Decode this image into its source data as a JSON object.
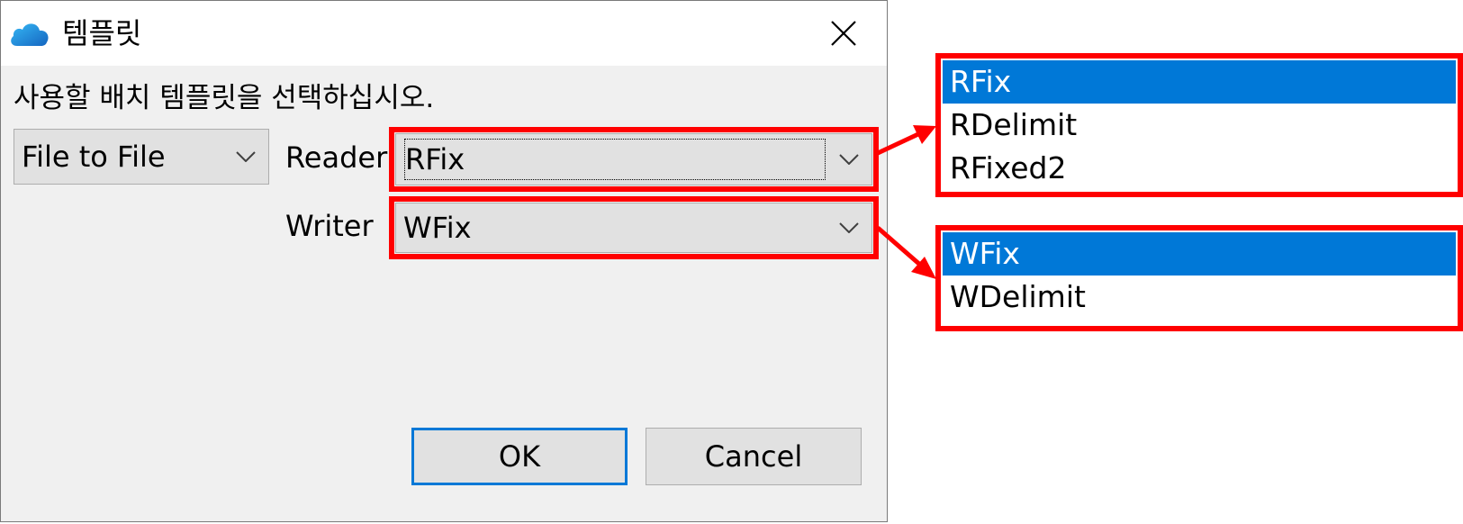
{
  "dialog": {
    "title": "템플릿",
    "instruction": "사용할 배치 템플릿을 선택하십시오.",
    "type_select": {
      "value": "File to File"
    },
    "reader": {
      "label": "Reader",
      "value": "RFix"
    },
    "writer": {
      "label": "Writer",
      "value": "WFix"
    },
    "ok_label": "OK",
    "cancel_label": "Cancel"
  },
  "reader_dropdown": {
    "options": [
      "RFix",
      "RDelimit",
      "RFixed2"
    ],
    "selected": "RFix"
  },
  "writer_dropdown": {
    "options": [
      "WFix",
      "WDelimit"
    ],
    "selected": "WFix"
  },
  "colors": {
    "highlight": "#ff0000",
    "selection": "#0078d7",
    "dialog_bg": "#f0f0f0"
  },
  "icons": {
    "app": "cloud-icon",
    "close": "close-icon",
    "dropdown": "chevron-down-icon"
  }
}
